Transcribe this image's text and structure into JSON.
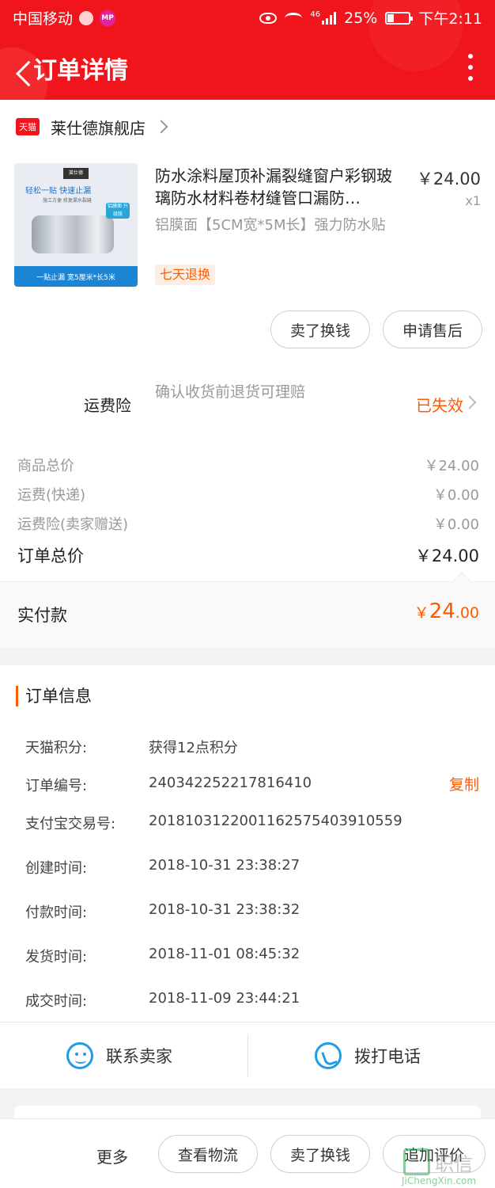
{
  "status_bar": {
    "carrier": "中国移动",
    "mp_label": "MP",
    "network": "46",
    "battery": "25%",
    "time": "下午2:11"
  },
  "header": {
    "title": "订单详情"
  },
  "shop": {
    "icon_label": "天猫",
    "name": "莱仕德旗舰店"
  },
  "product": {
    "image_texts": {
      "brand": "莱仕德",
      "headline": "轻松一贴 快速止漏",
      "sub": "施工方便 修复漏水裂缝",
      "badge": "铝膜面 升级版",
      "footer": "一贴止漏  宽5厘米*长5米"
    },
    "title": "防水涂料屋顶补漏裂缝窗户彩钢玻璃防水材料卷材缝管口漏防…",
    "spec": "铝膜面【5CM宽*5M长】强力防水贴",
    "tag": "七天退换",
    "price": "￥24.00",
    "qty": "x1"
  },
  "actions": {
    "sell": "卖了换钱",
    "after_sale": "申请售后"
  },
  "insurance": {
    "label": "运费险",
    "desc": "确认收货前退货可理赔",
    "status": "已失效"
  },
  "fees": [
    {
      "label": "商品总价",
      "value": "￥24.00"
    },
    {
      "label": "运费(快递)",
      "value": "￥0.00"
    },
    {
      "label": "运费险(卖家赠送)",
      "value": "￥0.00"
    }
  ],
  "total": {
    "label": "订单总价",
    "value": "￥24.00"
  },
  "paid": {
    "label": "实付款",
    "currency": "￥",
    "integer": "24",
    "decimal": ".00"
  },
  "order_info": {
    "heading": "订单信息",
    "copy_label": "复制",
    "rows": [
      {
        "key": "天猫积分:",
        "value": "获得12点积分"
      },
      {
        "key": "订单编号:",
        "value": "240342252217816410"
      },
      {
        "key": "支付宝交易号:",
        "value": "2018103122001162575403910559"
      },
      {
        "key": "创建时间:",
        "value": "2018-10-31 23:38:27"
      },
      {
        "key": "付款时间:",
        "value": "2018-10-31 23:38:32"
      },
      {
        "key": "发货时间:",
        "value": "2018-11-01 08:45:32"
      },
      {
        "key": "成交时间:",
        "value": "2018-11-09 23:44:21"
      }
    ]
  },
  "contact": {
    "seller": "联系卖家",
    "call": "拨打电话"
  },
  "bottom": {
    "more": "更多",
    "logistics": "查看物流",
    "sell": "卖了换钱",
    "review": "追加评价"
  },
  "watermark": {
    "cn": "职信",
    "url": "JiChengXin.com"
  },
  "colors": {
    "header_red": "#f0151c",
    "accent_orange": "#ff5a00",
    "icon_blue": "#1e9ce8"
  }
}
